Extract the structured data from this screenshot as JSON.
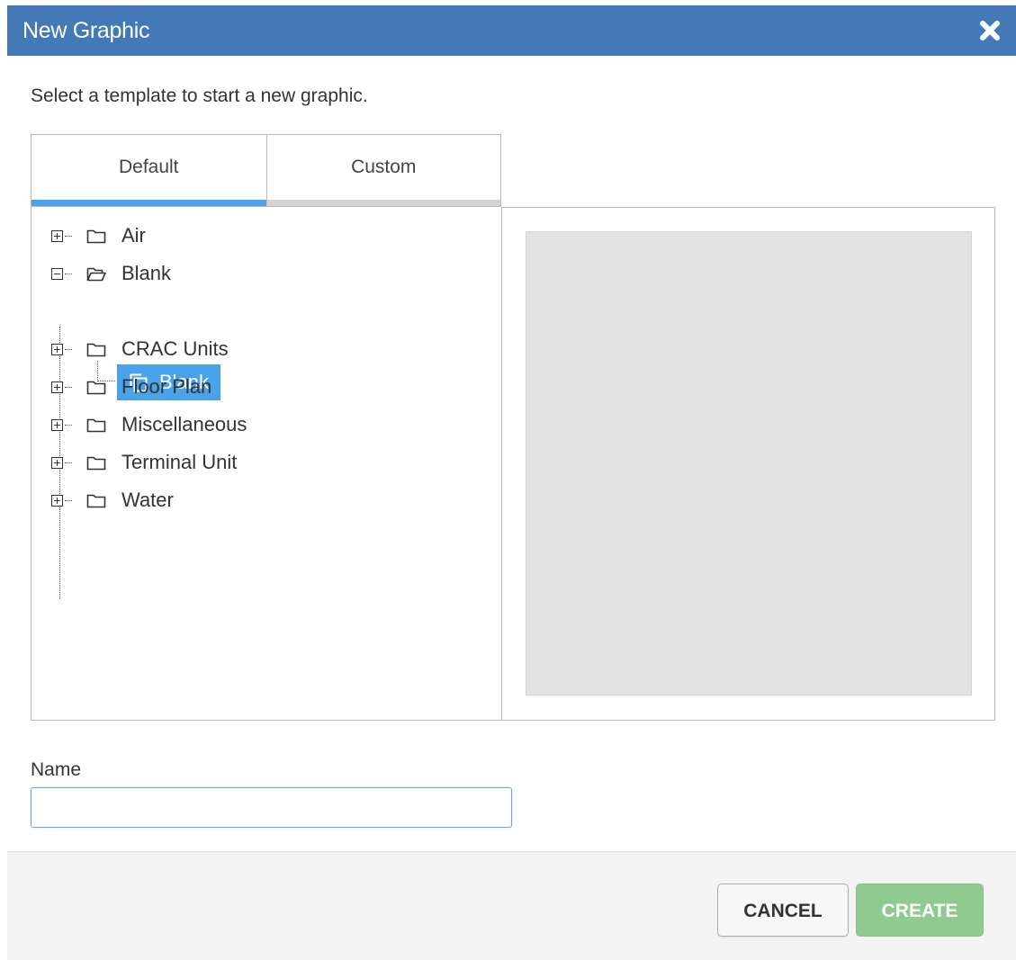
{
  "dialog": {
    "title": "New Graphic",
    "close_icon": "close-icon",
    "instruction": "Select a template to start a new graphic."
  },
  "tabs": [
    {
      "label": "Default",
      "active": true
    },
    {
      "label": "Custom",
      "active": false
    }
  ],
  "tree": {
    "items": [
      {
        "label": "Air",
        "expanded": false
      },
      {
        "label": "Blank",
        "expanded": true,
        "children": [
          {
            "label": "Blank",
            "selected": true
          }
        ]
      },
      {
        "label": "CRAC Units",
        "expanded": false
      },
      {
        "label": "Floor Plan",
        "expanded": false
      },
      {
        "label": "Miscellaneous",
        "expanded": false
      },
      {
        "label": "Terminal Unit",
        "expanded": false
      },
      {
        "label": "Water",
        "expanded": false
      }
    ]
  },
  "name_field": {
    "label": "Name",
    "value": "",
    "placeholder": ""
  },
  "footer": {
    "cancel_label": "CANCEL",
    "create_label": "CREATE"
  },
  "colors": {
    "title_bar": "#4279b6",
    "active_tab": "#4aa3e8",
    "selection": "#4aa3e8",
    "create_button": "#8fcb8e",
    "preview_background": "#e3e3e3"
  }
}
